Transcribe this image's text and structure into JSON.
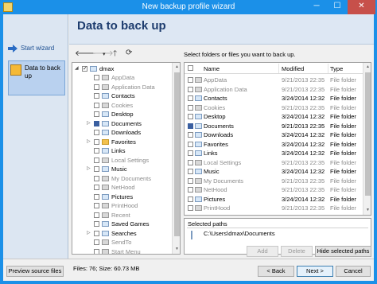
{
  "window": {
    "title": "New backup profile wizard",
    "min_glyph": "─",
    "max_glyph": "☐",
    "close_glyph": "✕"
  },
  "nav": {
    "items": [
      {
        "label": "Start wizard",
        "icon": "arrow-right-icon"
      },
      {
        "label": "Data to back up",
        "icon": "folder-data-icon"
      }
    ]
  },
  "header": {
    "title": "Data to back up"
  },
  "toolbar": {
    "back_glyph": "🡐",
    "forward_glyph": "🡒",
    "dropdown_glyph": "▾",
    "up_glyph": "🡑",
    "refresh_glyph": "⟳",
    "hint": "Select folders or files you want to back up."
  },
  "tree": {
    "root": "dmax",
    "items": [
      {
        "label": "AppData",
        "dim": true,
        "expandable": false,
        "icon": "sys"
      },
      {
        "label": "Application Data",
        "dim": true,
        "expandable": false,
        "icon": "sys"
      },
      {
        "label": "Contacts",
        "dim": false,
        "expandable": false,
        "icon": "user"
      },
      {
        "label": "Cookies",
        "dim": true,
        "expandable": false,
        "icon": "sys"
      },
      {
        "label": "Desktop",
        "dim": false,
        "expandable": false,
        "icon": "user"
      },
      {
        "label": "Documents",
        "dim": false,
        "expandable": true,
        "icon": "user",
        "partial": true
      },
      {
        "label": "Downloads",
        "dim": false,
        "expandable": false,
        "icon": "user"
      },
      {
        "label": "Favorites",
        "dim": false,
        "expandable": true,
        "icon": "folder"
      },
      {
        "label": "Links",
        "dim": false,
        "expandable": false,
        "icon": "user"
      },
      {
        "label": "Local Settings",
        "dim": true,
        "expandable": false,
        "icon": "sys"
      },
      {
        "label": "Music",
        "dim": false,
        "expandable": true,
        "icon": "user"
      },
      {
        "label": "My Documents",
        "dim": true,
        "expandable": false,
        "icon": "sys"
      },
      {
        "label": "NetHood",
        "dim": true,
        "expandable": false,
        "icon": "sys"
      },
      {
        "label": "Pictures",
        "dim": false,
        "expandable": false,
        "icon": "user"
      },
      {
        "label": "PrintHood",
        "dim": true,
        "expandable": false,
        "icon": "sys"
      },
      {
        "label": "Recent",
        "dim": true,
        "expandable": false,
        "icon": "sys"
      },
      {
        "label": "Saved Games",
        "dim": false,
        "expandable": false,
        "icon": "user"
      },
      {
        "label": "Searches",
        "dim": false,
        "expandable": true,
        "icon": "user"
      },
      {
        "label": "SendTo",
        "dim": true,
        "expandable": false,
        "icon": "sys"
      },
      {
        "label": "Start Menu",
        "dim": true,
        "expandable": false,
        "icon": "sys"
      }
    ]
  },
  "files": {
    "columns": [
      "Name",
      "Modified",
      "Type"
    ],
    "rows": [
      {
        "name": "AppData",
        "modified": "9/21/2013 22:35",
        "type": "File folder",
        "dim": true
      },
      {
        "name": "Application Data",
        "modified": "9/21/2013 22:35",
        "type": "File folder",
        "dim": true
      },
      {
        "name": "Contacts",
        "modified": "3/24/2014 12:32",
        "type": "File folder",
        "dim": false
      },
      {
        "name": "Cookies",
        "modified": "9/21/2013 22:35",
        "type": "File folder",
        "dim": true
      },
      {
        "name": "Desktop",
        "modified": "3/24/2014 12:32",
        "type": "File folder",
        "dim": false
      },
      {
        "name": "Documents",
        "modified": "9/21/2013 22:35",
        "type": "File folder",
        "dim": false
      },
      {
        "name": "Downloads",
        "modified": "3/24/2014 12:32",
        "type": "File folder",
        "dim": false
      },
      {
        "name": "Favorites",
        "modified": "3/24/2014 12:32",
        "type": "File folder",
        "dim": false
      },
      {
        "name": "Links",
        "modified": "3/24/2014 12:32",
        "type": "File folder",
        "dim": false
      },
      {
        "name": "Local Settings",
        "modified": "9/21/2013 22:35",
        "type": "File folder",
        "dim": true
      },
      {
        "name": "Music",
        "modified": "3/24/2014 12:32",
        "type": "File folder",
        "dim": false
      },
      {
        "name": "My Documents",
        "modified": "9/21/2013 22:35",
        "type": "File folder",
        "dim": true
      },
      {
        "name": "NetHood",
        "modified": "9/21/2013 22:35",
        "type": "File folder",
        "dim": true
      },
      {
        "name": "Pictures",
        "modified": "3/24/2014 12:32",
        "type": "File folder",
        "dim": false
      },
      {
        "name": "PrintHood",
        "modified": "9/21/2013 22:35",
        "type": "File folder",
        "dim": true
      }
    ]
  },
  "selected_paths": {
    "title": "Selected paths",
    "items": [
      "C:\\Users\\dmax\\Documents"
    ]
  },
  "buttons": {
    "add": "Add",
    "delete": "Delete",
    "hide_selected": "Hide selected paths",
    "preview": "Preview source files",
    "back": "< Back",
    "next": "Next >",
    "cancel": "Cancel"
  },
  "status": "Files: 76; Size: 60.73 MB",
  "colors": {
    "accent": "#1b90e8",
    "close": "#c7504a",
    "header_text": "#1d3c6e"
  }
}
